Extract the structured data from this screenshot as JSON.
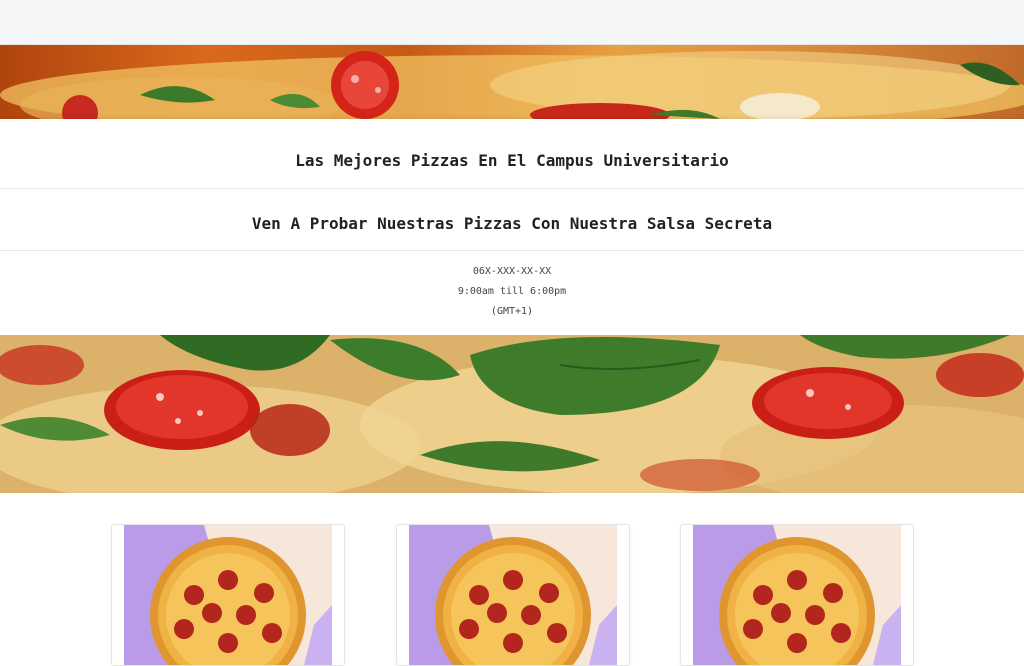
{
  "header": {
    "title": "",
    "bg_color": "#f5f6f8"
  },
  "hero": {
    "headline": "Las Mejores Pizzas En El Campus Universitario",
    "subheadline": "Ven A Probar Nuestras Pizzas Con Nuestra Salsa Secreta",
    "phone": "06X-XXX-XX-XX",
    "hours": "9:00am till 6:00pm",
    "timezone": "(GMT+1)"
  },
  "products": [
    {
      "image": "pepperoni-pizza-image"
    },
    {
      "image": "pepperoni-pizza-image"
    },
    {
      "image": "pepperoni-pizza-image"
    }
  ],
  "colors": {
    "text": "#222222",
    "card_bg_purple": "#b99be8",
    "card_bg_cream": "#f7e7da",
    "tomato": "#d8231c",
    "basil": "#3f7a2a"
  }
}
